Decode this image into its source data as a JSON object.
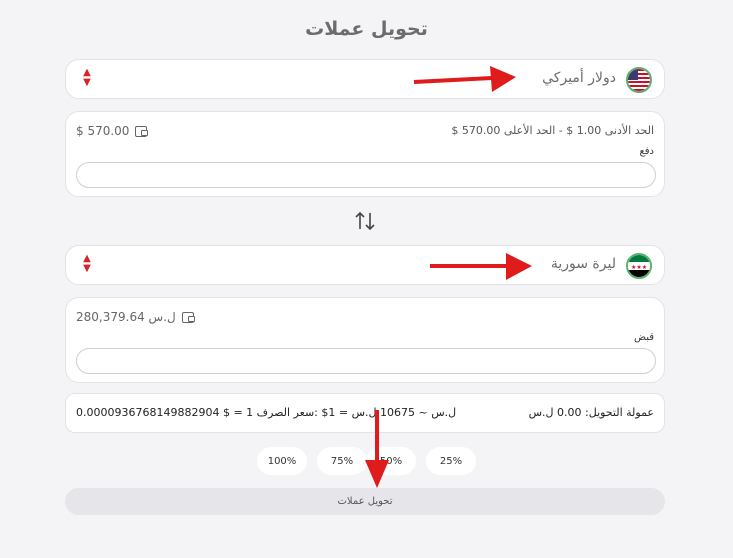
{
  "page": {
    "title": "تحويل عملات"
  },
  "from_currency": {
    "name": "دولار أميركي",
    "flag_icon": "us-flag-icon",
    "balance": "$ 570.00",
    "limits": "الحد الأدنى 1.00 $   -   الحد الأعلى 570.00 $",
    "field_label": "دفع",
    "input_value": ""
  },
  "to_currency": {
    "name": "ليرة سورية",
    "flag_icon": "syria-flag-icon",
    "balance": "280,379.64 ل.س",
    "field_label": "قبض",
    "input_value": ""
  },
  "info": {
    "fee": "عمولة التحويل: 0.00 ل.س",
    "rate": "0.0000936768149882904 $ = 1 ل.س ~ 10675 ل.س = 1$ :سعر الصرف"
  },
  "percent_buttons": [
    "100%",
    "75%",
    "50%",
    "25%"
  ],
  "convert_button": "تحويل عملات",
  "colors": {
    "accent_red": "#d9232a",
    "background": "#f4f4f6",
    "card": "#ffffff"
  }
}
